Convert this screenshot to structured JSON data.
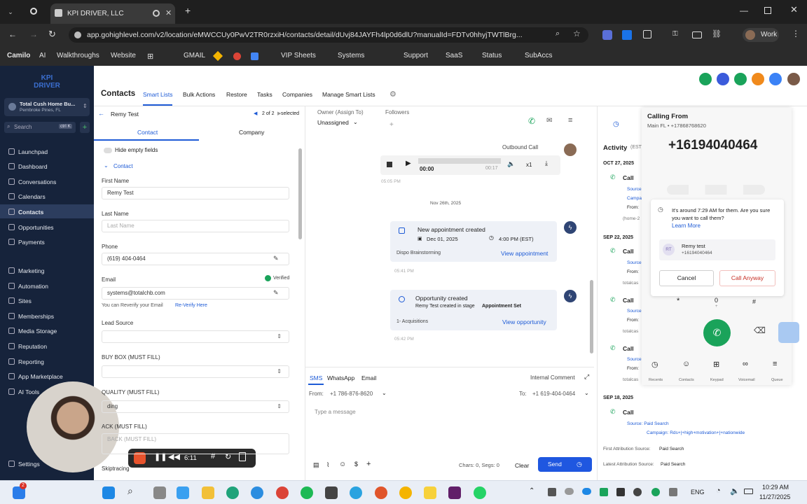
{
  "browser": {
    "tab_title": "KPI DRIVER, LLC",
    "url": "app.gohighlevel.com/v2/location/eMWCCUy0PwV2TR0rzxiH/contacts/detail/dUvj84JAYFh4lp0d6dlU?manualId=FDTv0hhyjTWTlBrg...",
    "profile": "Work",
    "bookmarks": [
      "Camilo",
      "AI",
      "Walkthroughs",
      "Website",
      "GMAIL",
      "VIP Sheets",
      "Systems",
      "Support",
      "SaaS",
      "Status",
      "SubAccs"
    ]
  },
  "sidebar": {
    "account_name": "Total Cush Home Bu...",
    "account_location": "Pembroke Pines, FL",
    "search_placeholder": "Search",
    "search_shortcut": "ctrl K",
    "items": [
      "Launchpad",
      "Dashboard",
      "Conversations",
      "Calendars",
      "Contacts",
      "Opportunities",
      "Payments",
      "Marketing",
      "Automation",
      "Sites",
      "Memberships",
      "Media Storage",
      "Reputation",
      "Reporting",
      "App Marketplace",
      "AI Tools",
      "Settings"
    ]
  },
  "header": {
    "title": "Contacts",
    "tabs": [
      "Smart Lists",
      "Bulk Actions",
      "Restore",
      "Tasks",
      "Companies",
      "Manage Smart Lists"
    ]
  },
  "contact": {
    "back_name": "Remy Test",
    "pager": "2 of 2",
    "selected": "selected",
    "tabs": [
      "Contact",
      "Company"
    ],
    "hide_empty": "Hide empty fields",
    "section": "Contact",
    "first_name_label": "First Name",
    "first_name": "Remy Test",
    "last_name_label": "Last Name",
    "last_name_placeholder": "Last Name",
    "phone_label": "Phone",
    "phone": "(619) 404-0464",
    "email_label": "Email",
    "verified": "Verified",
    "email": "systems@totalchb.com",
    "reverify_text": "You can Reverify your Email",
    "reverify_link": "Re-Verify Here",
    "lead_source_label": "Lead Source",
    "buy_box_label": "BUY BOX (MUST FILL)",
    "quality_label": "QUALITY (MUST FILL)",
    "quality_value": "ding",
    "back_label": "ACK (MUST FILL)",
    "back_placeholder": "BACK (MUST FILL)",
    "skip_label": "Skiptracing"
  },
  "conversation": {
    "owner_label": "Owner (Assign To)",
    "owner_value": "Unassigned",
    "followers_label": "Followers",
    "outbound": "Outbound Call",
    "audio_time": "00:00",
    "audio_total": "00:17",
    "speed": "x1",
    "time1": "05:05 PM",
    "date_sep": "Nov 26th, 2025",
    "appt_title": "New appointment created",
    "appt_date": "Dec 01, 2025",
    "appt_time": "4:00 PM (EST)",
    "appt_cal": "Dispo Brainstorming",
    "appt_link": "View appointment",
    "time2": "05:41 PM",
    "opp_title": "Opportunity created",
    "opp_desc": "Remy Test created in stage",
    "opp_stage": "Appointment Set",
    "opp_pipeline": "1- Acquisitions",
    "opp_link": "View opportunity",
    "time3": "05:42 PM",
    "compose_tabs": [
      "SMS",
      "WhatsApp",
      "Email"
    ],
    "internal_comment": "Internal Comment",
    "from_label": "From:",
    "from_value": "+1 786-876-8620",
    "to_label": "To:",
    "to_value": "+1 619-404-0464",
    "message_placeholder": "Type a message",
    "chars": "Chars: 0, Segs: 0",
    "clear": "Clear",
    "send": "Send"
  },
  "activity": {
    "title": "Activity",
    "title_suffix": "(EST",
    "entries": [
      {
        "date": "OCT 27, 2025",
        "type": "Call",
        "lines": [
          "Source:",
          "Campaign:",
          "From:",
          "(home-2"
        ]
      },
      {
        "date": "SEP 22, 2025",
        "type": "Call",
        "lines": [
          "Source:",
          "From:",
          "totalcas"
        ]
      },
      {
        "date": "",
        "type": "Call",
        "lines": [
          "Source:",
          "From:",
          "totalcas"
        ]
      },
      {
        "date": "",
        "type": "Call",
        "lines": [
          "Source:",
          "From:",
          "totalcas"
        ]
      },
      {
        "date": "SEP 18, 2025",
        "type": "Call",
        "lines": [
          "Source: Paid Search",
          "Campaign: Rds+|+high+motivation+|+nationwide"
        ]
      }
    ],
    "first_attr_label": "First Attribution Source:",
    "first_attr": "Paid Search",
    "latest_attr_label": "Latest Attribution Source:",
    "latest_attr": "Paid Search"
  },
  "dialer": {
    "calling_from": "Calling From",
    "line": "Main FL • +17868768620",
    "number": "+16194040464",
    "warning": "It's around 7:29 AM for them. Are you sure you want to call them?",
    "learn_more": "Learn More",
    "contact_initials": "RT",
    "contact_name": "Remy test",
    "contact_phone": "+16194040464",
    "cancel": "Cancel",
    "call_anyway": "Call Anyway",
    "keys": [
      "*",
      "0",
      "#"
    ],
    "key_sub": "+",
    "nav": [
      "Recents",
      "Contacts",
      "Keypad",
      "Voicemail",
      "Queue"
    ]
  },
  "recorder": {
    "time": "6:11"
  },
  "taskbar": {
    "lang": "ENG",
    "time": "10:29 AM",
    "date": "11/27/2025",
    "badge": "2"
  },
  "colors": {
    "sidebar": "#16233b",
    "accent": "#1e5bd6",
    "green": "#1aa35a",
    "send": "#1f57e0"
  }
}
